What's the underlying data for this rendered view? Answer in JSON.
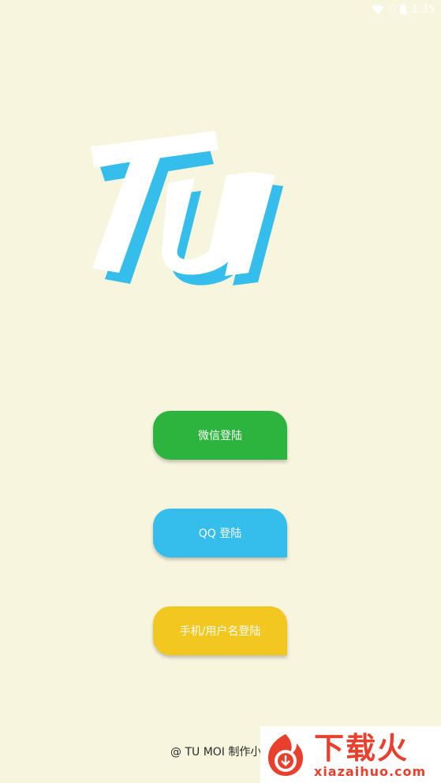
{
  "status_bar": {
    "time": "1:35"
  },
  "logo": {
    "text": "Tu",
    "color_fg": "#ffffff",
    "color_shadow": "#35bdeb"
  },
  "buttons": {
    "wechat": {
      "label": "微信登陆",
      "color": "#2db43f"
    },
    "qq": {
      "label": "QQ 登陆",
      "color": "#35bdeb"
    },
    "phone": {
      "label": "手机/用户名登陆",
      "color": "#f2c71f"
    }
  },
  "footer": {
    "text": "@ TU MOI 制作小"
  },
  "watermark": {
    "title": "下载火",
    "subtitle": "xiazaihuo.com",
    "color": "#e8402d"
  }
}
